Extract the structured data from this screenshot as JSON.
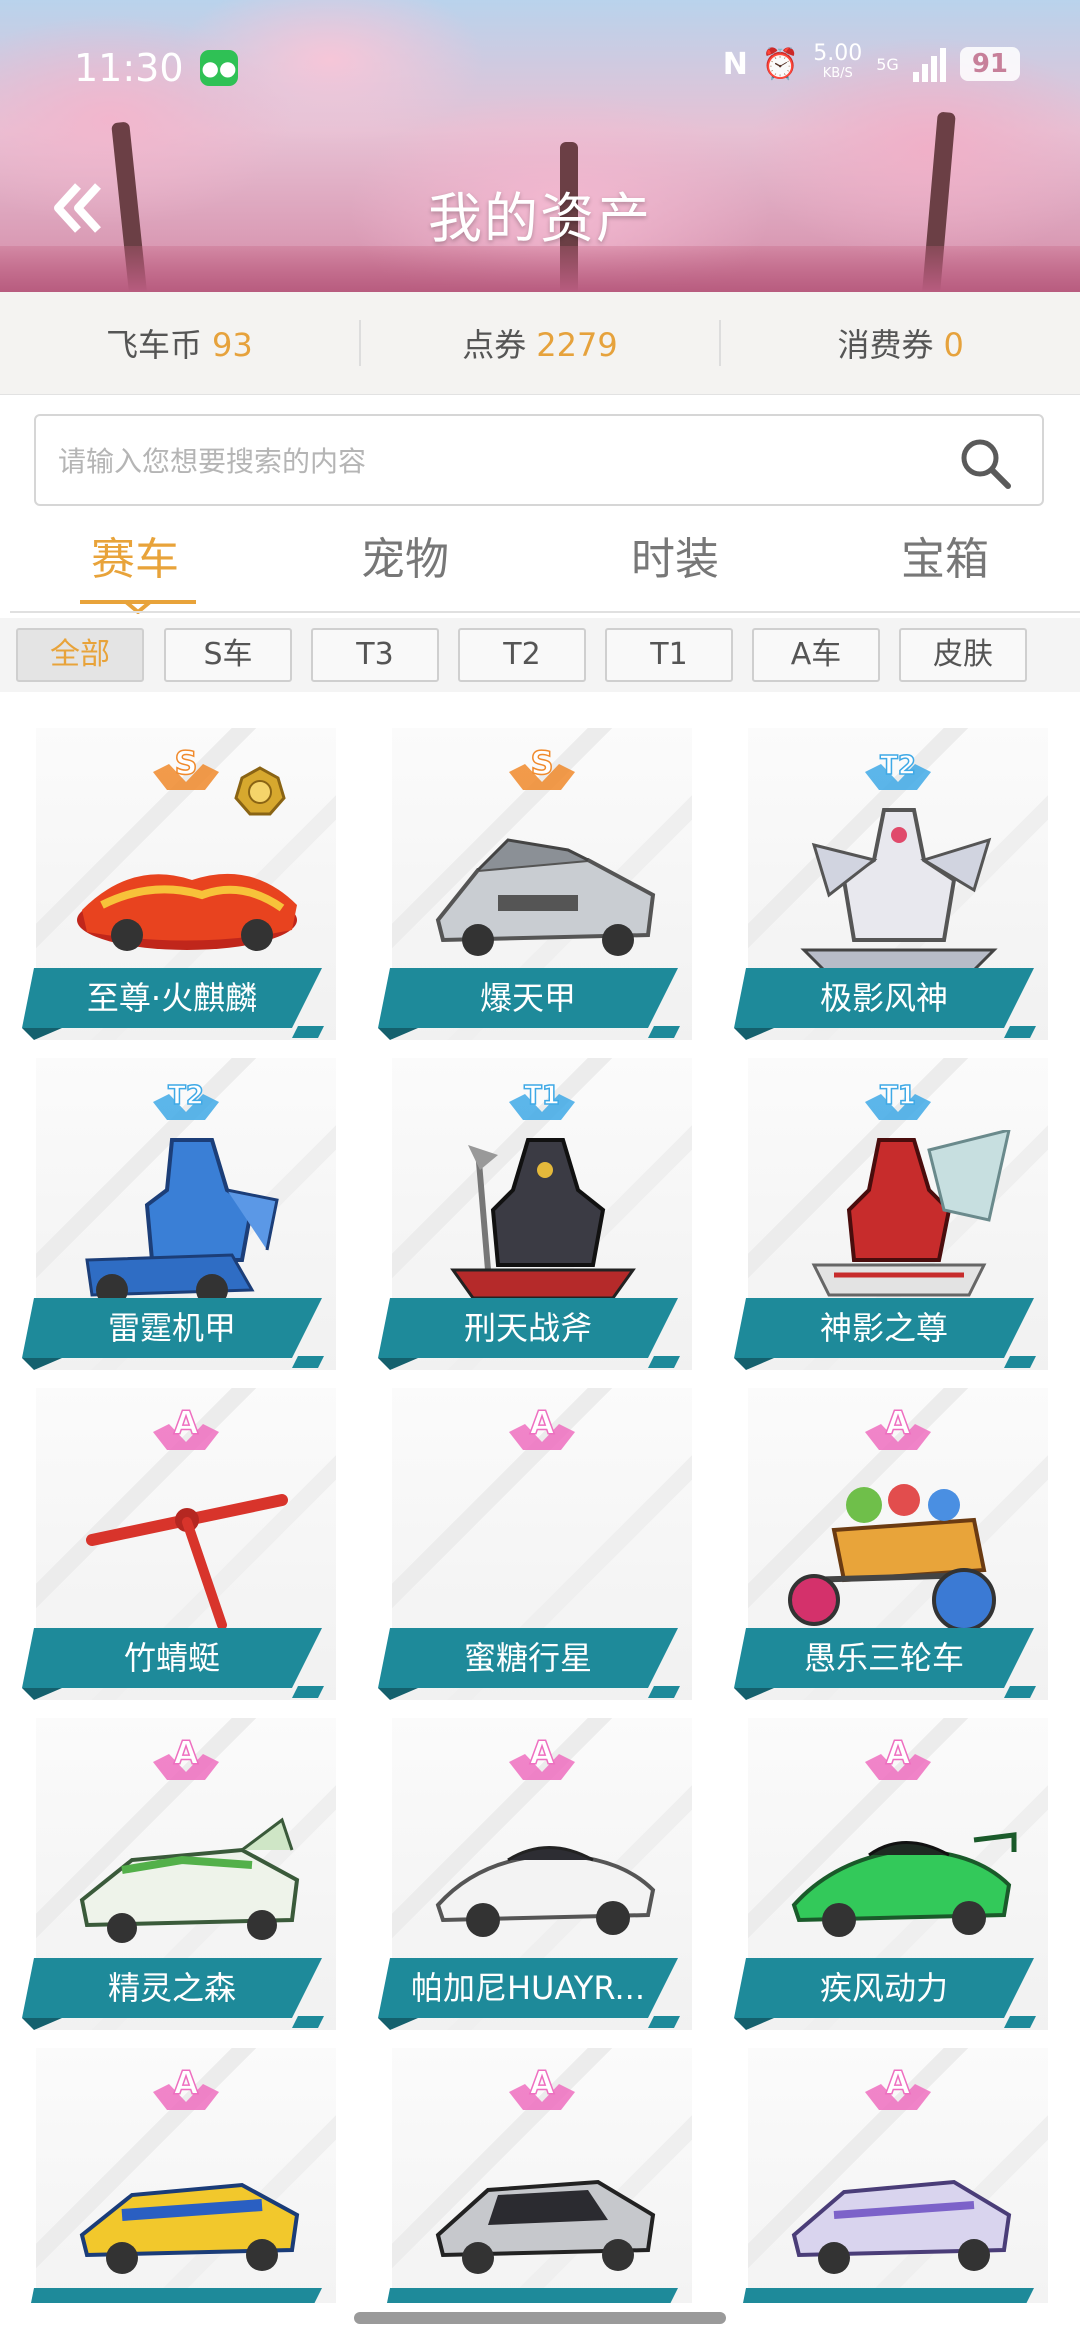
{
  "status_bar": {
    "time": "11:30",
    "notification_icon": "wechat-icon",
    "nfc_label": "N",
    "net_speed": "5.00",
    "net_speed_unit": "KB/S",
    "network": "5G",
    "battery": "91"
  },
  "header": {
    "title": "我的资产",
    "back_icon": "double-chevron-left-icon"
  },
  "currencies": [
    {
      "label": "飞车币",
      "value": "93"
    },
    {
      "label": "点券",
      "value": "2279"
    },
    {
      "label": "消费券",
      "value": "0"
    }
  ],
  "search": {
    "placeholder": "请输入您想要搜索的内容",
    "icon": "search-icon"
  },
  "tabs": [
    {
      "label": "赛车",
      "active": true
    },
    {
      "label": "宠物",
      "active": false
    },
    {
      "label": "时装",
      "active": false
    },
    {
      "label": "宝箱",
      "active": false
    }
  ],
  "filters": [
    {
      "label": "全部",
      "active": true
    },
    {
      "label": "S车",
      "active": false
    },
    {
      "label": "T3",
      "active": false
    },
    {
      "label": "T2",
      "active": false
    },
    {
      "label": "T1",
      "active": false
    },
    {
      "label": "A车",
      "active": false
    },
    {
      "label": "皮肤",
      "active": false
    }
  ],
  "items": [
    {
      "name": "至尊·火麒麟",
      "rank": "S",
      "extra_badge": "medal-icon",
      "art": "red-flame-car"
    },
    {
      "name": "爆天甲",
      "rank": "S",
      "art": "silver-armored-car"
    },
    {
      "name": "极影风神",
      "rank": "T2",
      "art": "white-mecha-car"
    },
    {
      "name": "雷霆机甲",
      "rank": "T2",
      "art": "blue-mecha-car"
    },
    {
      "name": "刑天战斧",
      "rank": "T1",
      "art": "dark-mecha-car"
    },
    {
      "name": "神影之尊",
      "rank": "T1",
      "art": "red-winged-mecha-car"
    },
    {
      "name": "竹蜻蜓",
      "rank": "A",
      "art": "bamboo-copter"
    },
    {
      "name": "蜜糖行星",
      "rank": "A",
      "art": "empty"
    },
    {
      "name": "愚乐三轮车",
      "rank": "A",
      "art": "toy-tricycle"
    },
    {
      "name": "精灵之森",
      "rank": "A",
      "art": "green-white-racer"
    },
    {
      "name": "帕加尼HUAYR...",
      "rank": "A",
      "art": "white-supercar"
    },
    {
      "name": "疾风动力",
      "rank": "A",
      "art": "green-supercar"
    },
    {
      "name": "",
      "rank": "A",
      "art": "yellow-blue-racer"
    },
    {
      "name": "",
      "rank": "A",
      "art": "silver-black-racer"
    },
    {
      "name": "",
      "rank": "A",
      "art": "lilac-racer"
    }
  ],
  "colors": {
    "accent_orange": "#e8a33a",
    "label_teal": "#1e8a9a",
    "rank_S": "#f08a2c",
    "rank_T": "#3fa9e6",
    "rank_A": "#ee6fc0"
  }
}
